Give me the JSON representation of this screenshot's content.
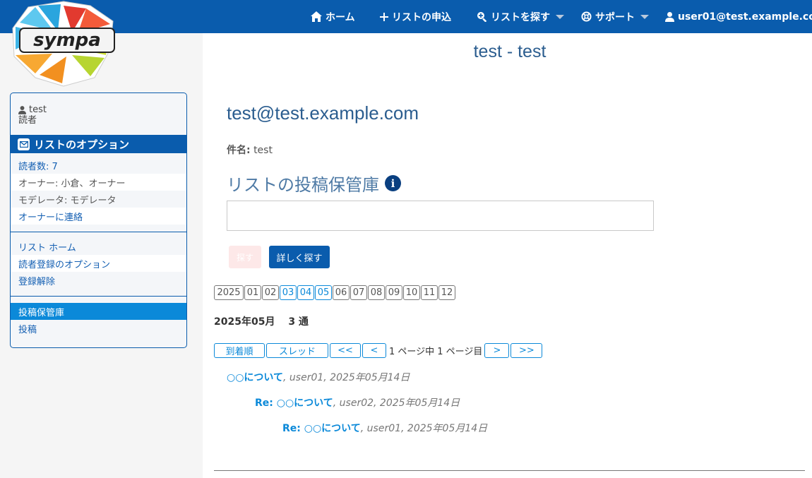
{
  "nav": {
    "home": "ホーム",
    "create_list": "リストの申込",
    "search_lists": "リストを探す",
    "support": "サポート",
    "user": "user01@test.example.com"
  },
  "logo": {
    "text": "sympa"
  },
  "sidebar": {
    "user_name": "test",
    "user_role": "読者",
    "options_title": "リストのオプション",
    "info_rows": [
      {
        "label": "読者数: 7"
      },
      {
        "label": "オーナー: 小倉、オーナー"
      },
      {
        "label": "モデレータ: モデレータ"
      },
      {
        "label": "オーナーに連絡"
      }
    ],
    "nav_rows": [
      {
        "label": "リスト ホーム"
      },
      {
        "label": "読者登録のオプション"
      },
      {
        "label": "登録解除"
      }
    ],
    "archive_rows": [
      {
        "label": "投稿保管庫"
      },
      {
        "label": "投稿"
      }
    ]
  },
  "main": {
    "page_title": "test - test",
    "list_address": "test@test.example.com",
    "subject_label": "件名:",
    "subject_value": "test",
    "archive_title": "リストの投稿保管庫",
    "search_value": "",
    "search_button": "探す",
    "advanced_button": "詳しく探す",
    "year": "2025",
    "months": [
      "01",
      "02",
      "03",
      "04",
      "05",
      "06",
      "07",
      "08",
      "09",
      "10",
      "11",
      "12"
    ],
    "months_with_posts": [
      "03",
      "04",
      "05"
    ],
    "period": "2025年05月　 3 通",
    "pager": {
      "by_date": "到着順",
      "by_thread": "スレッド",
      "first": "<<",
      "prev": "<",
      "page_info": "1 ページ中 1 ページ目",
      "next": ">",
      "last": ">>"
    },
    "messages": [
      {
        "subject": "○○について",
        "meta": ", user01, 2025年05月14日"
      },
      {
        "subject": "Re: ○○について",
        "meta": ", user02, 2025年05月14日"
      },
      {
        "subject": "Re: ○○について",
        "meta": ", user01, 2025年05月14日"
      }
    ]
  }
}
